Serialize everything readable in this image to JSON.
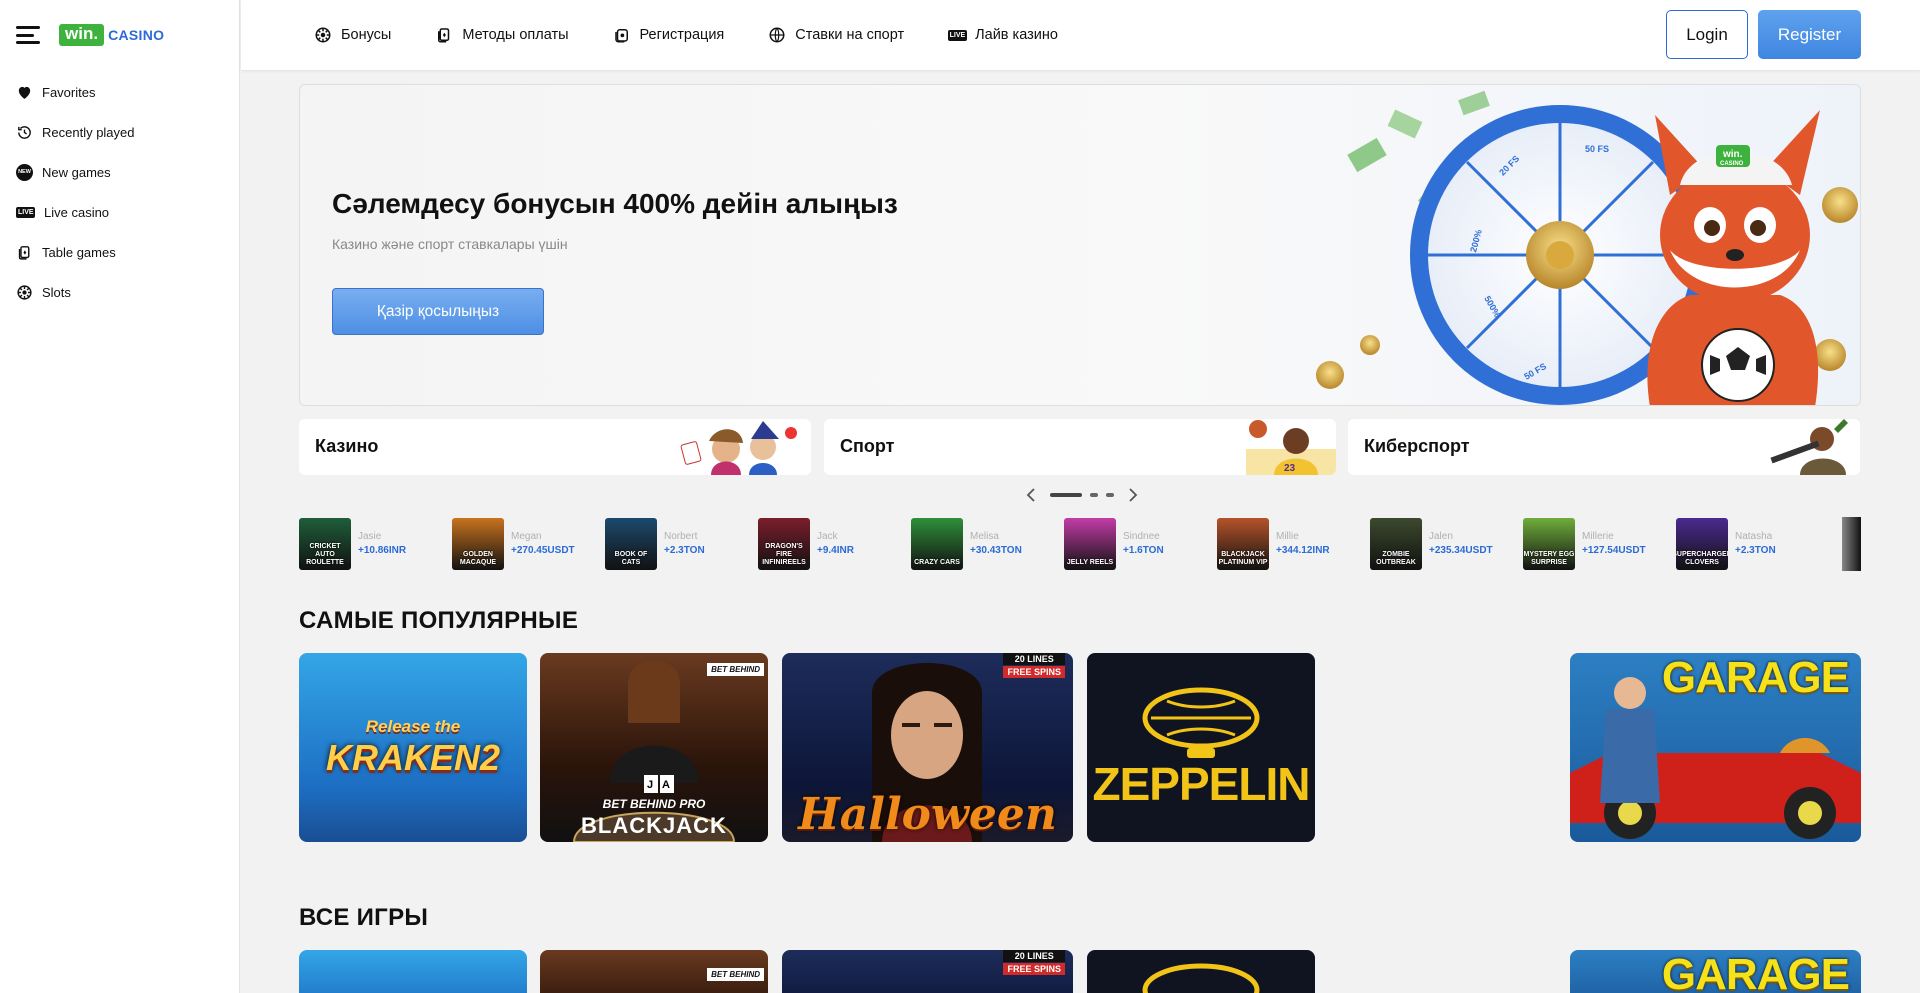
{
  "sidebar": {
    "logo_box": "win.",
    "logo_text": "CASINO",
    "items": [
      {
        "label": "Favorites",
        "icon": "heart-icon"
      },
      {
        "label": "Recently played",
        "icon": "history-icon"
      },
      {
        "label": "New games",
        "icon": "new-badge-icon",
        "badge": "NEW"
      },
      {
        "label": "Live casino",
        "icon": "live-badge-icon",
        "badge": "LIVE"
      },
      {
        "label": "Table games",
        "icon": "cards-icon"
      },
      {
        "label": "Slots",
        "icon": "slots-icon"
      }
    ]
  },
  "header": {
    "nav": [
      {
        "label": "Бонусы",
        "icon": "bonus-icon"
      },
      {
        "label": "Методы оплаты",
        "icon": "payment-icon"
      },
      {
        "label": "Регистрация",
        "icon": "registration-icon"
      },
      {
        "label": "Ставки на спорт",
        "icon": "sport-ball-icon"
      },
      {
        "label": "Лайв казино",
        "icon": "live-icon",
        "badge": "LIVE"
      }
    ],
    "login_label": "Login",
    "register_label": "Register"
  },
  "hero": {
    "title": "Сәлемдесу бонусын 400% дейін алыңыз",
    "subtitle": "Казино және спорт ставкалары үшін",
    "button_label": "Қазір қосылыңыз",
    "art_badge": "win.",
    "art_badge_sub": "CASINO",
    "wheel_labels": [
      "50 FS",
      "20 FS",
      "200%",
      "500%",
      "50 FS"
    ]
  },
  "categories": [
    {
      "label": "Казино"
    },
    {
      "label": "Спорт"
    },
    {
      "label": "Киберспорт"
    }
  ],
  "carousel": {
    "pages": 3,
    "active": 0
  },
  "winners": [
    {
      "name": "Jasie",
      "amount": "+10.86INR",
      "game": "CRICKET AUTO ROULETTE",
      "color": "#1f5e3a"
    },
    {
      "name": "Megan",
      "amount": "+270.45USDT",
      "game": "GOLDEN MACAQUE",
      "color": "#c8731e"
    },
    {
      "name": "Norbert",
      "amount": "+2.3TON",
      "game": "BOOK OF CATS",
      "color": "#1c4a6e"
    },
    {
      "name": "Jack",
      "amount": "+9.4INR",
      "game": "DRAGON'S FIRE INFINIREELS",
      "color": "#7a1e2b"
    },
    {
      "name": "Melisa",
      "amount": "+30.43TON",
      "game": "CRAZY CARS",
      "color": "#2f8f3a"
    },
    {
      "name": "Sindnee",
      "amount": "+1.6TON",
      "game": "JELLY REELS",
      "color": "#c23ca6"
    },
    {
      "name": "Millie",
      "amount": "+344.12INR",
      "game": "BLACKJACK PLATINUM VIP",
      "color": "#b5542a"
    },
    {
      "name": "Jalen",
      "amount": "+235.34USDT",
      "game": "ZOMBIE OUTBREAK",
      "color": "#3c4a2e"
    },
    {
      "name": "Millerie",
      "amount": "+127.54USDT",
      "game": "MYSTERY EGG SURPRISE",
      "color": "#6fae3b"
    },
    {
      "name": "Natasha",
      "amount": "+2.3TON",
      "game": "SUPERCHARGED CLOVERS",
      "color": "#4b2a8f"
    }
  ],
  "popular": {
    "title": "САМЫЕ ПОПУЛЯРНЫЕ",
    "games": [
      {
        "name": "Release the KRAKEN 2",
        "art": "Release the",
        "art2": "KRAKEN2"
      },
      {
        "name": "Bet Behind Pro Blackjack",
        "art": "BET BEHIND PRO",
        "art2": "BLACKJACK",
        "corner": "BET BEHIND"
      },
      {
        "name": "Halloween",
        "art": "Halloween",
        "badge_lines": "20 LINES",
        "badge_spins": "FREE SPINS"
      },
      {
        "name": "Zeppelin",
        "art": "ZEPPELIN"
      },
      {
        "name": "Garage",
        "art": "GARAGE"
      }
    ]
  },
  "all_games": {
    "title": "ВСЕ ИГРЫ"
  },
  "colors": {
    "accent": "#2a6bd6",
    "logo_green": "#3db33d",
    "register_bg": "#4a8fe4"
  }
}
